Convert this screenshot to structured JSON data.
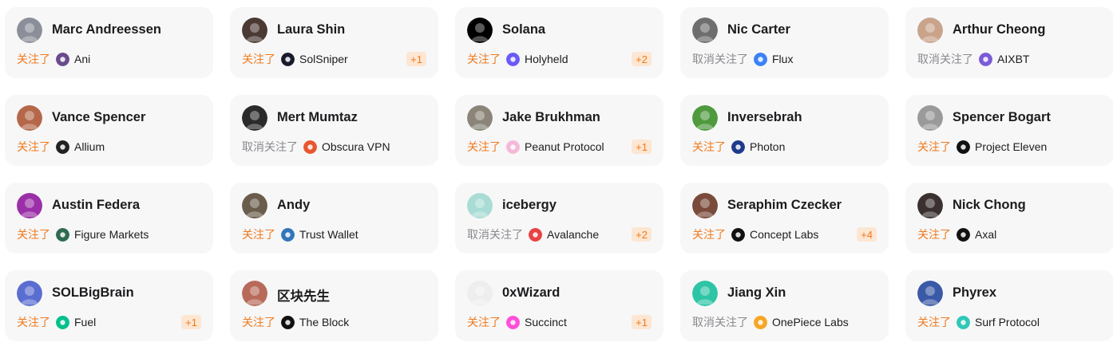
{
  "cards": [
    {
      "name": "Marc Andreessen",
      "status": "关注了",
      "status_type": "follow",
      "project": "Ani",
      "project_icon": "ani-icon",
      "avatar": "marc-andreessen-avatar",
      "avatar_color": "#8b8f99",
      "icon_color": "#6a4b8c",
      "more": ""
    },
    {
      "name": "Laura Shin",
      "status": "关注了",
      "status_type": "follow",
      "project": "SolSniper",
      "project_icon": "solsniper-icon",
      "avatar": "laura-shin-avatar",
      "avatar_color": "#4a3a33",
      "icon_color": "#1a1a2e",
      "more": "+1"
    },
    {
      "name": "Solana",
      "status": "关注了",
      "status_type": "follow",
      "project": "Holyheld",
      "project_icon": "holyheld-icon",
      "avatar": "solana-avatar",
      "avatar_color": "#000000",
      "icon_color": "#6a5af9",
      "more": "+2"
    },
    {
      "name": "Nic Carter",
      "status": "取消关注了",
      "status_type": "unfollow",
      "project": "Flux",
      "project_icon": "flux-icon",
      "avatar": "nic-carter-avatar",
      "avatar_color": "#6e6e6e",
      "icon_color": "#3b82f6",
      "more": ""
    },
    {
      "name": "Arthur Cheong",
      "status": "取消关注了",
      "status_type": "unfollow",
      "project": "AIXBT",
      "project_icon": "aixbt-icon",
      "avatar": "arthur-cheong-avatar",
      "avatar_color": "#c9a38a",
      "icon_color": "#7c5cd6",
      "more": ""
    },
    {
      "name": "Vance Spencer",
      "status": "关注了",
      "status_type": "follow",
      "project": "Allium",
      "project_icon": "allium-icon",
      "avatar": "vance-spencer-avatar",
      "avatar_color": "#b5674a",
      "icon_color": "#222222",
      "more": ""
    },
    {
      "name": "Mert Mumtaz",
      "status": "取消关注了",
      "status_type": "unfollow",
      "project": "Obscura VPN",
      "project_icon": "obscura-vpn-icon",
      "avatar": "mert-mumtaz-avatar",
      "avatar_color": "#2b2b2b",
      "icon_color": "#e8572f",
      "more": ""
    },
    {
      "name": "Jake Brukhman",
      "status": "关注了",
      "status_type": "follow",
      "project": "Peanut Protocol",
      "project_icon": "peanut-protocol-icon",
      "avatar": "jake-brukhman-avatar",
      "avatar_color": "#8a8578",
      "icon_color": "#f4b9d8",
      "more": "+1"
    },
    {
      "name": "Inversebrah",
      "status": "关注了",
      "status_type": "follow",
      "project": "Photon",
      "project_icon": "photon-icon",
      "avatar": "inversebrah-avatar",
      "avatar_color": "#4f9a3e",
      "icon_color": "#1e3a8a",
      "more": ""
    },
    {
      "name": "Spencer Bogart",
      "status": "关注了",
      "status_type": "follow",
      "project": "Project Eleven",
      "project_icon": "project-eleven-icon",
      "avatar": "spencer-bogart-avatar",
      "avatar_color": "#9a9a9a",
      "icon_color": "#111111",
      "more": ""
    },
    {
      "name": "Austin Federa",
      "status": "关注了",
      "status_type": "follow",
      "project": "Figure Markets",
      "project_icon": "figure-markets-icon",
      "avatar": "austin-federa-avatar",
      "avatar_color": "#9b2fa8",
      "icon_color": "#2f6b4f",
      "more": ""
    },
    {
      "name": "Andy",
      "status": "关注了",
      "status_type": "follow",
      "project": "Trust Wallet",
      "project_icon": "trust-wallet-icon",
      "avatar": "andy-avatar",
      "avatar_color": "#6b5d4c",
      "icon_color": "#3375bb",
      "more": ""
    },
    {
      "name": "icebergy",
      "status": "取消关注了",
      "status_type": "unfollow",
      "project": "Avalanche",
      "project_icon": "avalanche-icon",
      "avatar": "icebergy-avatar",
      "avatar_color": "#a8dcd4",
      "icon_color": "#e84142",
      "more": "+2"
    },
    {
      "name": "Seraphim Czecker",
      "status": "关注了",
      "status_type": "follow",
      "project": "Concept Labs",
      "project_icon": "concept-labs-icon",
      "avatar": "seraphim-czecker-avatar",
      "avatar_color": "#7a4a3a",
      "icon_color": "#111111",
      "more": "+4"
    },
    {
      "name": "Nick Chong",
      "status": "关注了",
      "status_type": "follow",
      "project": "Axal",
      "project_icon": "axal-icon",
      "avatar": "nick-chong-avatar",
      "avatar_color": "#3a3030",
      "icon_color": "#111111",
      "more": ""
    },
    {
      "name": "SOLBigBrain",
      "status": "关注了",
      "status_type": "follow",
      "project": "Fuel",
      "project_icon": "fuel-icon",
      "avatar": "solbigbrain-avatar",
      "avatar_color": "#5a6dd0",
      "icon_color": "#00c08b",
      "more": "+1"
    },
    {
      "name": "区块先生",
      "status": "关注了",
      "status_type": "follow",
      "project": "The Block",
      "project_icon": "the-block-icon",
      "avatar": "qukuai-xiansheng-avatar",
      "avatar_color": "#b86a5a",
      "icon_color": "#111111",
      "more": ""
    },
    {
      "name": "0xWizard",
      "status": "关注了",
      "status_type": "follow",
      "project": "Succinct",
      "project_icon": "succinct-icon",
      "avatar": "0xwizard-avatar",
      "avatar_color": "#eeeeee",
      "icon_color": "#ff4fd8",
      "more": "+1"
    },
    {
      "name": "Jiang Xin",
      "status": "取消关注了",
      "status_type": "unfollow",
      "project": "OnePiece Labs",
      "project_icon": "onepiece-labs-icon",
      "avatar": "jiang-xin-avatar",
      "avatar_color": "#2ec4a6",
      "icon_color": "#f5a623",
      "more": ""
    },
    {
      "name": "Phyrex",
      "status": "关注了",
      "status_type": "follow",
      "project": "Surf Protocol",
      "project_icon": "surf-protocol-icon",
      "avatar": "phyrex-avatar",
      "avatar_color": "#3a5aa8",
      "icon_color": "#2fc7b8",
      "more": ""
    }
  ]
}
